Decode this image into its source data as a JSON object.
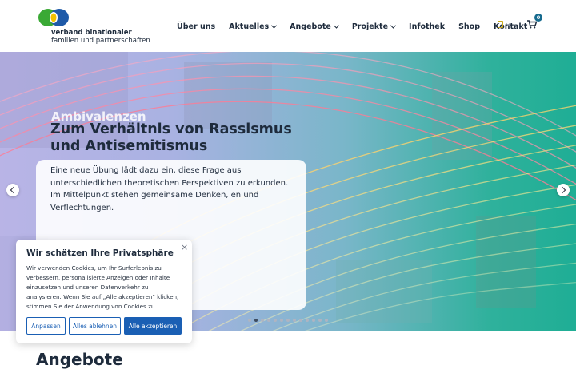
{
  "header": {
    "logo": {
      "line1": "verband binationaler",
      "line2": "familien und partnerschaften"
    },
    "nav": [
      {
        "label": "Über uns",
        "has_dropdown": false
      },
      {
        "label": "Aktuelles",
        "has_dropdown": true
      },
      {
        "label": "Angebote",
        "has_dropdown": true
      },
      {
        "label": "Projekte",
        "has_dropdown": true
      },
      {
        "label": "Infothek",
        "has_dropdown": false
      },
      {
        "label": "Shop",
        "has_dropdown": false
      },
      {
        "label": "Kontakt",
        "has_dropdown": false
      }
    ],
    "language_icon": "language-flag-icon",
    "cart": {
      "icon": "cart-icon",
      "count": "0"
    }
  },
  "hero": {
    "slide": {
      "kicker": "Ambivalenzen",
      "title": "Zum Verhältnis von Rassismus und Antisemitismus",
      "text": "Eine neue Übung lädt dazu ein, diese Frage aus unterschiedlichen theoretischen Perspektiven zu erkunden. Im Mittelpunkt stehen gemeinsame Denken, en und Verflechtungen."
    },
    "dots_total": 13,
    "dots_active_index": 1,
    "prev_icon": "chevron-left-icon",
    "next_icon": "chevron-right-icon"
  },
  "section": {
    "title": "Angebote"
  },
  "cookie_banner": {
    "title": "Wir schätzen Ihre Privatsphäre",
    "text": "Wir verwenden Cookies, um Ihr Surferlebnis zu verbessern, personalisierte Anzeigen oder Inhalte einzusetzen und unseren Datenverkehr zu analysieren. Wenn Sie auf „Alle akzeptieren\" klicken, stimmen Sie der Anwendung von Cookies zu.",
    "close_label": "×",
    "buttons": {
      "customize": "Anpassen",
      "reject": "Alles ablehnen",
      "accept": "Alle akzeptieren"
    }
  },
  "colors": {
    "brand_blue": "#1a5fb4",
    "hero_green": "#1fae95",
    "hero_lilac": "#b9b4e6",
    "logo_green": "#3aa935",
    "logo_blue": "#1e5aa8"
  }
}
